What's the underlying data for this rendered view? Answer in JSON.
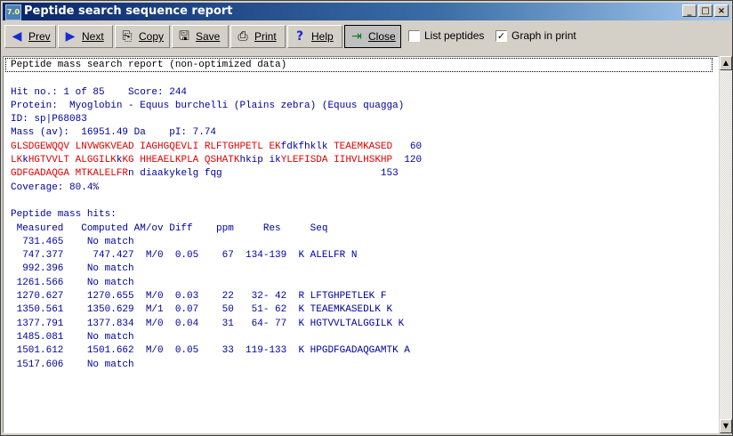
{
  "window": {
    "icon_text": "7.0",
    "title": "Peptide search sequence report",
    "minimize": "_",
    "maximize": "□",
    "close": "×"
  },
  "toolbar": {
    "prev": "Prev",
    "next": "Next",
    "copy": "Copy",
    "save": "Save",
    "print": "Print",
    "help": "Help",
    "close": "Close",
    "list_peptides": {
      "label": "List peptides",
      "checked": false
    },
    "graph_in_print": {
      "label": "Graph in print",
      "checked": true
    }
  },
  "report": {
    "header": "Peptide mass search report (non-optimized data)",
    "hit_line": "Hit no.: 1 of 85    Score: 244",
    "protein_line": "Protein:  Myoglobin - Equus burchelli (Plains zebra) (Equus quagga)",
    "id_line": "ID: sp|P68083",
    "mass_line": "Mass (av):  16951.49 Da    pI: 7.74",
    "seq1": {
      "red1": "GLSDGEWQQV LNVWGKVEAD IAGHGQEVLI RLFTGHPETL EK",
      "blue1": "fdkfhklk",
      "red2": " TEAEMKASED",
      "num": "   60"
    },
    "seq2": {
      "red1": "LK",
      "blue1": "k",
      "red2": "HGTVVLT ALGGILK",
      "blue2": "k",
      "red3": "KG HHEAELKPLA QSHATK",
      "blue3": "hkip ik",
      "red4": "YLEFISDA IIHVLHSKHP",
      "num": "  120"
    },
    "seq3": {
      "red1": "GDFGADAQGA MTKALELFR",
      "blue1": "n diaakykelg fqg",
      "num": "                           153"
    },
    "coverage": "Coverage: 80.4%",
    "hits_title": "Peptide mass hits:",
    "columns": " Measured   Computed AM/ov Diff    ppm     Res     Seq",
    "rows": [
      "  731.465    No match",
      "  747.377     747.427  M/0  0.05    67  134-139  K ALELFR N",
      "  992.396    No match",
      " 1261.566    No match",
      " 1270.627    1270.655  M/0  0.03    22   32- 42  R LFTGHPETLEK F",
      " 1350.561    1350.629  M/1  0.07    50   51- 62  K TEAEMKASEDLK K",
      " 1377.791    1377.834  M/0  0.04    31   64- 77  K HGTVVLTALGGILK K",
      " 1485.081    No match",
      " 1501.612    1501.662  M/0  0.05    33  119-133  K HPGDFGADAQGAMTK A",
      " 1517.606    No match"
    ]
  },
  "scrollbar": {
    "up": "▲",
    "down": "▼"
  }
}
